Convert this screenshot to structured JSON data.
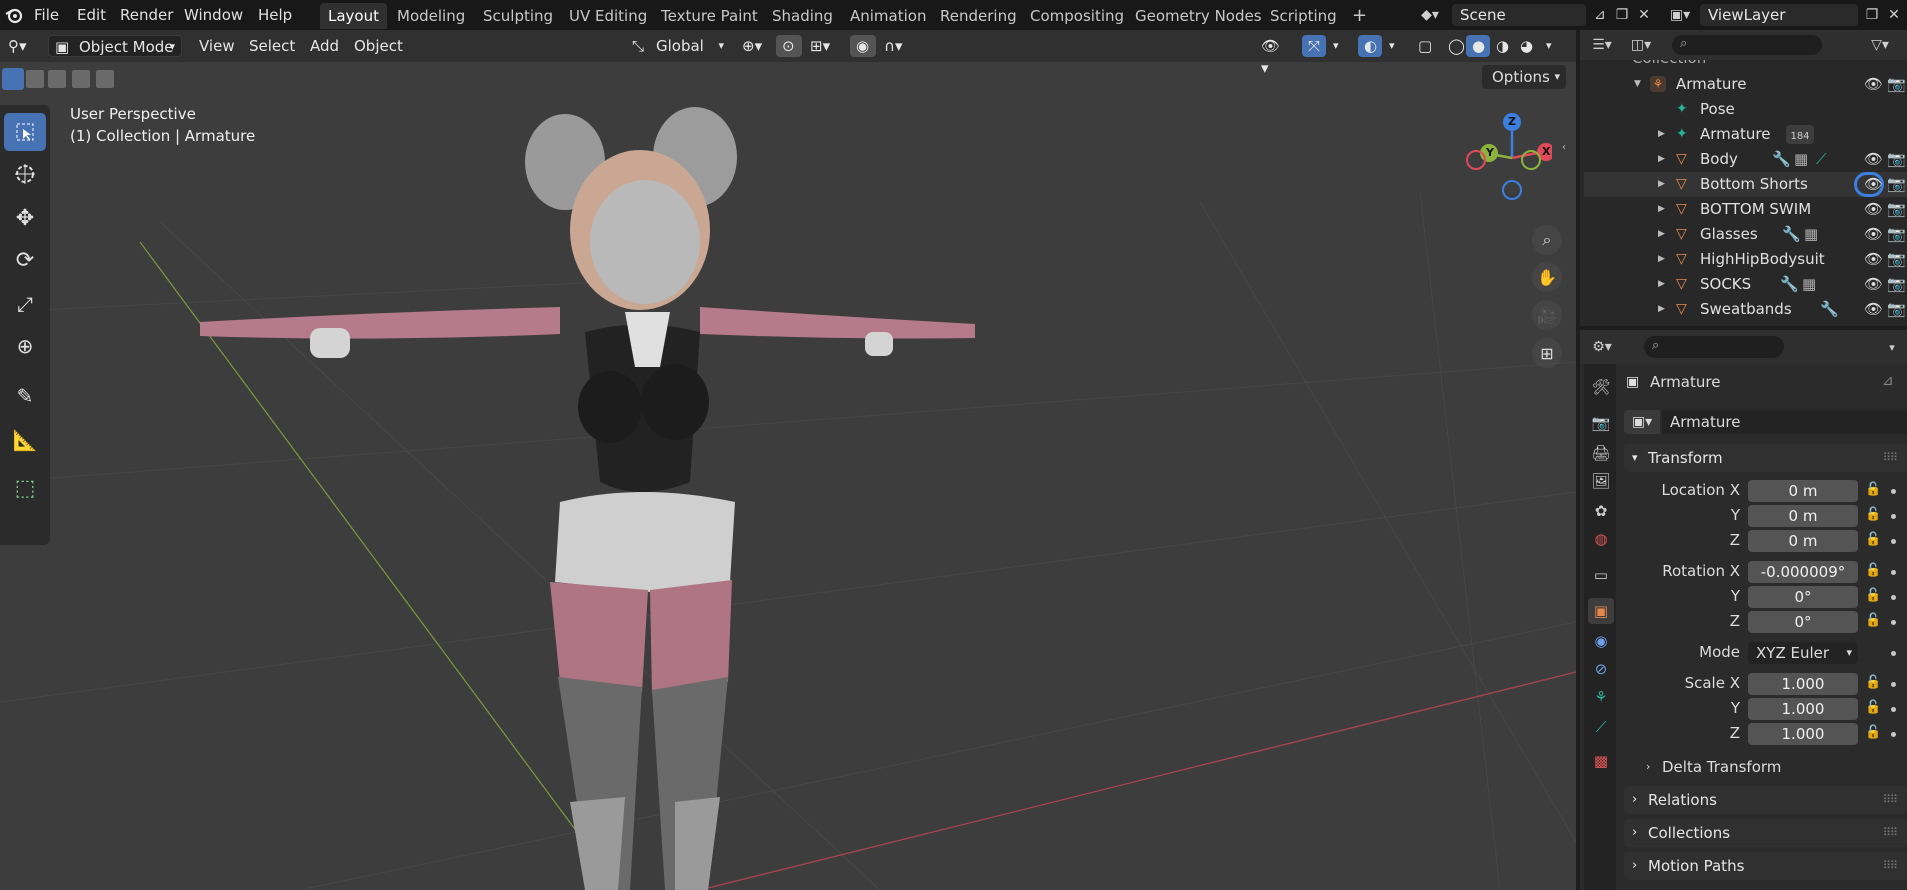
{
  "colors": {
    "accent": "#4772b3",
    "viewport_bg": "#3d3d3d",
    "axis_x": "#e04a5a",
    "axis_y": "#8cb43c",
    "axis_z": "#3b7fe0",
    "object_icon": "#e8884a",
    "armature_icon": "#27b39a"
  },
  "menubar": {
    "items": [
      "File",
      "Edit",
      "Render",
      "Window",
      "Help"
    ],
    "workspaces": [
      "Layout",
      "Modeling",
      "Sculpting",
      "UV Editing",
      "Texture Paint",
      "Shading",
      "Animation",
      "Rendering",
      "Compositing",
      "Geometry Nodes",
      "Scripting"
    ],
    "active_workspace": "Layout",
    "add_tab": "+",
    "scene": "Scene",
    "view_layer": "ViewLayer"
  },
  "viewport_header": {
    "mode": "Object Mode",
    "menus": [
      "View",
      "Select",
      "Add",
      "Object"
    ],
    "orientation": "Global",
    "options": "Options"
  },
  "viewport_overlay": {
    "perspective": "User Perspective",
    "context": "(1) Collection | Armature",
    "gizmo_labels": {
      "z": "Z",
      "y": "Y",
      "x": "X"
    }
  },
  "tools": [
    "select-box",
    "cursor",
    "move",
    "rotate",
    "scale",
    "transform",
    "annotate",
    "measure",
    "add-cube"
  ],
  "outliner": {
    "header_partial": "Collection",
    "rows": [
      {
        "name": "Armature",
        "icon": "armature",
        "expanded": true
      },
      {
        "name": "Pose",
        "icon": "pose"
      },
      {
        "name": "Armature",
        "icon": "armature-data",
        "badge": "184"
      },
      {
        "name": "Body",
        "icon": "mesh"
      },
      {
        "name": "Bottom Shorts",
        "icon": "mesh"
      },
      {
        "name": "BOTTOM SWIM",
        "icon": "mesh"
      },
      {
        "name": "Glasses",
        "icon": "mesh"
      },
      {
        "name": "HighHipBodysuit",
        "icon": "mesh"
      },
      {
        "name": "SOCKS",
        "icon": "mesh"
      },
      {
        "name": "Sweatbands",
        "icon": "mesh"
      }
    ]
  },
  "properties": {
    "object_name": "Armature",
    "datablock": "Armature",
    "transform_label": "Transform",
    "location_label": "Location X",
    "location": [
      "0 m",
      "0 m",
      "0 m"
    ],
    "rotation_label": "Rotation X",
    "rotation": [
      "-0.000009°",
      "0°",
      "0°"
    ],
    "mode_label": "Mode",
    "rotation_mode": "XYZ Euler",
    "scale_label": "Scale X",
    "scale": [
      "1.000",
      "1.000",
      "1.000"
    ],
    "y_label": "Y",
    "z_label": "Z",
    "delta_transform": "Delta Transform",
    "relations": "Relations",
    "collections": "Collections",
    "motion_paths": "Motion Paths"
  }
}
